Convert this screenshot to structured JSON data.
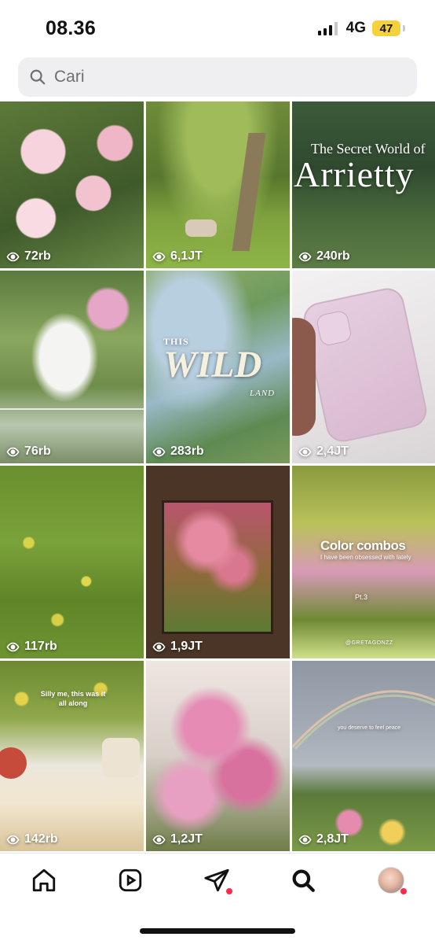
{
  "status_bar": {
    "time": "08.36",
    "network": "4G",
    "battery": "47"
  },
  "search": {
    "placeholder": "Cari"
  },
  "tiles": [
    {
      "views": "72rb",
      "overlay_title": "",
      "overlay_sub": ""
    },
    {
      "views": "6,1JT",
      "overlay_title": "",
      "overlay_sub": ""
    },
    {
      "views": "240rb",
      "overlay_title": "The Secret World of",
      "overlay_sub": "Arrietty"
    },
    {
      "views": "76rb",
      "overlay_title": "",
      "overlay_sub": ""
    },
    {
      "views": "283rb",
      "overlay_title": "WILD",
      "overlay_pre": "THIS",
      "overlay_sub": "LAND"
    },
    {
      "views": "2,4JT",
      "overlay_title": "",
      "overlay_sub": ""
    },
    {
      "views": "117rb",
      "overlay_title": "",
      "overlay_sub": ""
    },
    {
      "views": "1,9JT",
      "overlay_title": "",
      "overlay_sub": ""
    },
    {
      "views": "",
      "overlay_title": "Color combos",
      "overlay_sub": "I have been obsessed with lately",
      "overlay_tag": "Pt.3",
      "overlay_credit": "@GRETAGONZZ"
    },
    {
      "views": "142rb",
      "overlay_title": "Silly me, this was it all along",
      "overlay_sub": ""
    },
    {
      "views": "1,2JT",
      "overlay_title": "",
      "overlay_sub": ""
    },
    {
      "views": "2,8JT",
      "overlay_title": "you deserve to feel peace",
      "overlay_sub": ""
    }
  ],
  "tabbar": {
    "items": [
      "home-icon",
      "reels-icon",
      "send-icon",
      "search-icon",
      "profile-avatar"
    ]
  },
  "colors": {
    "notification_dot": "#ff2b4a",
    "battery_fill": "#f5d23b",
    "search_bg": "#efeff1"
  }
}
